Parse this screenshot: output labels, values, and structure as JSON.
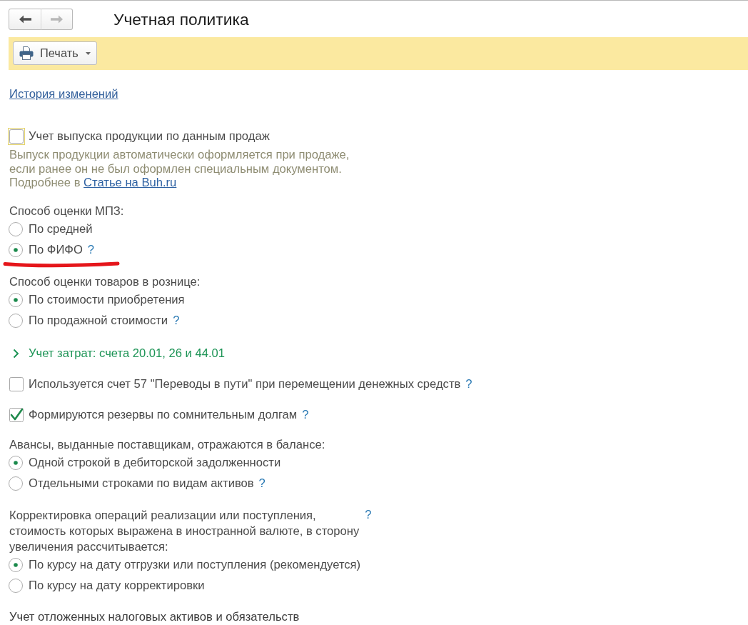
{
  "navigation": {
    "buttons": [
      {
        "kind": "back",
        "disabled": false
      },
      {
        "kind": "forward",
        "disabled": true
      }
    ]
  },
  "window": {
    "title": "Учетная политика"
  },
  "toolbar": {
    "buttons": [
      {
        "kind": "print",
        "label": "Печать",
        "dropdown": true
      }
    ]
  },
  "history_link": {
    "label": "История изменений"
  },
  "sections": [
    {
      "kind": "checkbox",
      "label": "Учет выпуска продукции по данным продаж",
      "checked": false,
      "focused": true
    },
    {
      "kind": "hint",
      "text": "Выпуск продукции автоматически оформляется при продаже,\nесли ранее он не был оформлен специальным документом.\nПодробнее в",
      "link": "Статье на Buh.ru"
    },
    {
      "kind": "radio_group",
      "label": "Способ оценки МПЗ:",
      "options": [
        {
          "label": "По средней",
          "selected": false,
          "marked": false
        },
        {
          "label": "По ФИФО",
          "help": "?",
          "selected": true,
          "marked": true
        }
      ]
    },
    {
      "kind": "radio_group",
      "label": "Способ оценки товаров в рознице:",
      "options": [
        {
          "label": "По стоимости приобретения",
          "selected": true,
          "marked": false
        },
        {
          "label": "По продажной стоимости",
          "help": "?",
          "selected": false,
          "marked": false
        }
      ]
    },
    {
      "kind": "collapsible",
      "label": "Учет затрат: счета 20.01, 26 и 44.01",
      "expanded": false
    },
    {
      "kind": "checkbox",
      "label": "Используется счет 57 \"Переводы в пути\" при перемещении денежных средств",
      "help": "?",
      "checked": false,
      "focused": false
    },
    {
      "kind": "checkbox",
      "label": "Формируются резервы по сомнительным долгам",
      "help": "?",
      "checked": true,
      "focused": false
    },
    {
      "kind": "radio_group",
      "label": "Авансы, выданные поставщикам, отражаются в балансе:",
      "options": [
        {
          "label": "Одной строкой в дебиторской задолженности",
          "selected": true,
          "marked": false
        },
        {
          "label": "Отдельными строками по видам активов",
          "help": "?",
          "selected": false,
          "marked": false
        }
      ]
    },
    {
      "kind": "radio_group",
      "label": "Корректировка операций реализации или поступления,\nстоимость которых выражена в иностранной валюте, в сторону\nувеличения рассчитывается:",
      "help": "?",
      "options": [
        {
          "label": "По курсу на дату отгрузки или поступления (рекомендуется)",
          "selected": true,
          "marked": false
        },
        {
          "label": "По курсу на дату корректировки",
          "selected": false,
          "marked": false
        }
      ]
    },
    {
      "kind": "heading",
      "label": "Учет отложенных налоговых активов и обязательств"
    }
  ]
}
